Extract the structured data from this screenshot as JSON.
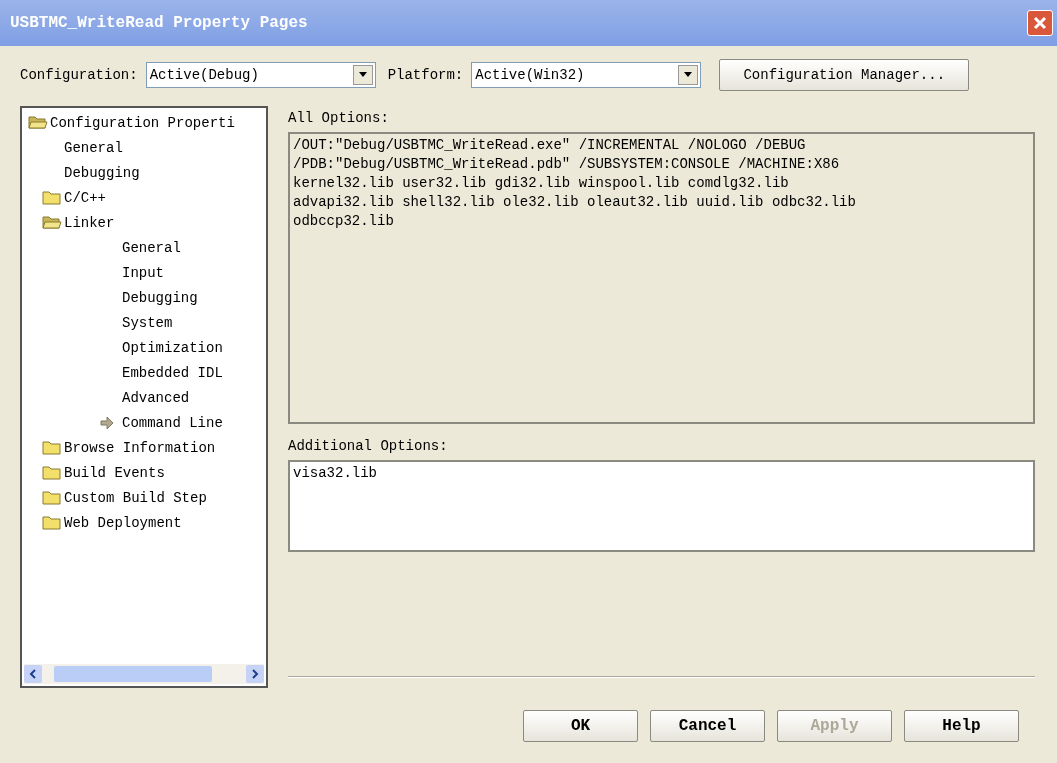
{
  "window": {
    "title": "USBTMC_WriteRead Property Pages"
  },
  "configuration": {
    "label": "Configuration:",
    "value": "Active(Debug)"
  },
  "platform": {
    "label": "Platform:",
    "value": "Active(Win32)"
  },
  "configuration_manager_button": "Configuration Manager...",
  "tree": [
    {
      "label": "Configuration Properti",
      "expanded": true,
      "selected": false,
      "children": [
        {
          "label": "General",
          "selected": false
        },
        {
          "label": "Debugging",
          "selected": false
        },
        {
          "label": "C/C++",
          "expanded": false,
          "selected": false
        },
        {
          "label": "Linker",
          "expanded": true,
          "selected": false,
          "children": [
            {
              "label": "General",
              "selected": false
            },
            {
              "label": "Input",
              "selected": false
            },
            {
              "label": "Debugging",
              "selected": false
            },
            {
              "label": "System",
              "selected": false
            },
            {
              "label": "Optimization",
              "selected": false
            },
            {
              "label": "Embedded IDL",
              "selected": false
            },
            {
              "label": "Advanced",
              "selected": false
            },
            {
              "label": "Command Line",
              "selected": true
            }
          ]
        },
        {
          "label": "Browse Information",
          "expanded": false,
          "selected": false
        },
        {
          "label": "Build Events",
          "expanded": false,
          "selected": false
        },
        {
          "label": "Custom Build Step",
          "expanded": false,
          "selected": false
        },
        {
          "label": "Web Deployment",
          "expanded": false,
          "selected": false
        }
      ]
    }
  ],
  "all_options": {
    "label": "All Options:",
    "value": "/OUT:\"Debug/USBTMC_WriteRead.exe\" /INCREMENTAL /NOLOGO /DEBUG\n/PDB:\"Debug/USBTMC_WriteRead.pdb\" /SUBSYSTEM:CONSOLE /MACHINE:X86\nkernel32.lib user32.lib gdi32.lib winspool.lib comdlg32.lib\nadvapi32.lib shell32.lib ole32.lib oleaut32.lib uuid.lib odbc32.lib\nodbccp32.lib"
  },
  "additional_options": {
    "label": "Additional Options:",
    "value": "visa32.lib"
  },
  "buttons": [
    {
      "label": "OK",
      "disabled": false
    },
    {
      "label": "Cancel",
      "disabled": false
    },
    {
      "label": "Apply",
      "disabled": true
    },
    {
      "label": "Help",
      "disabled": false
    }
  ]
}
